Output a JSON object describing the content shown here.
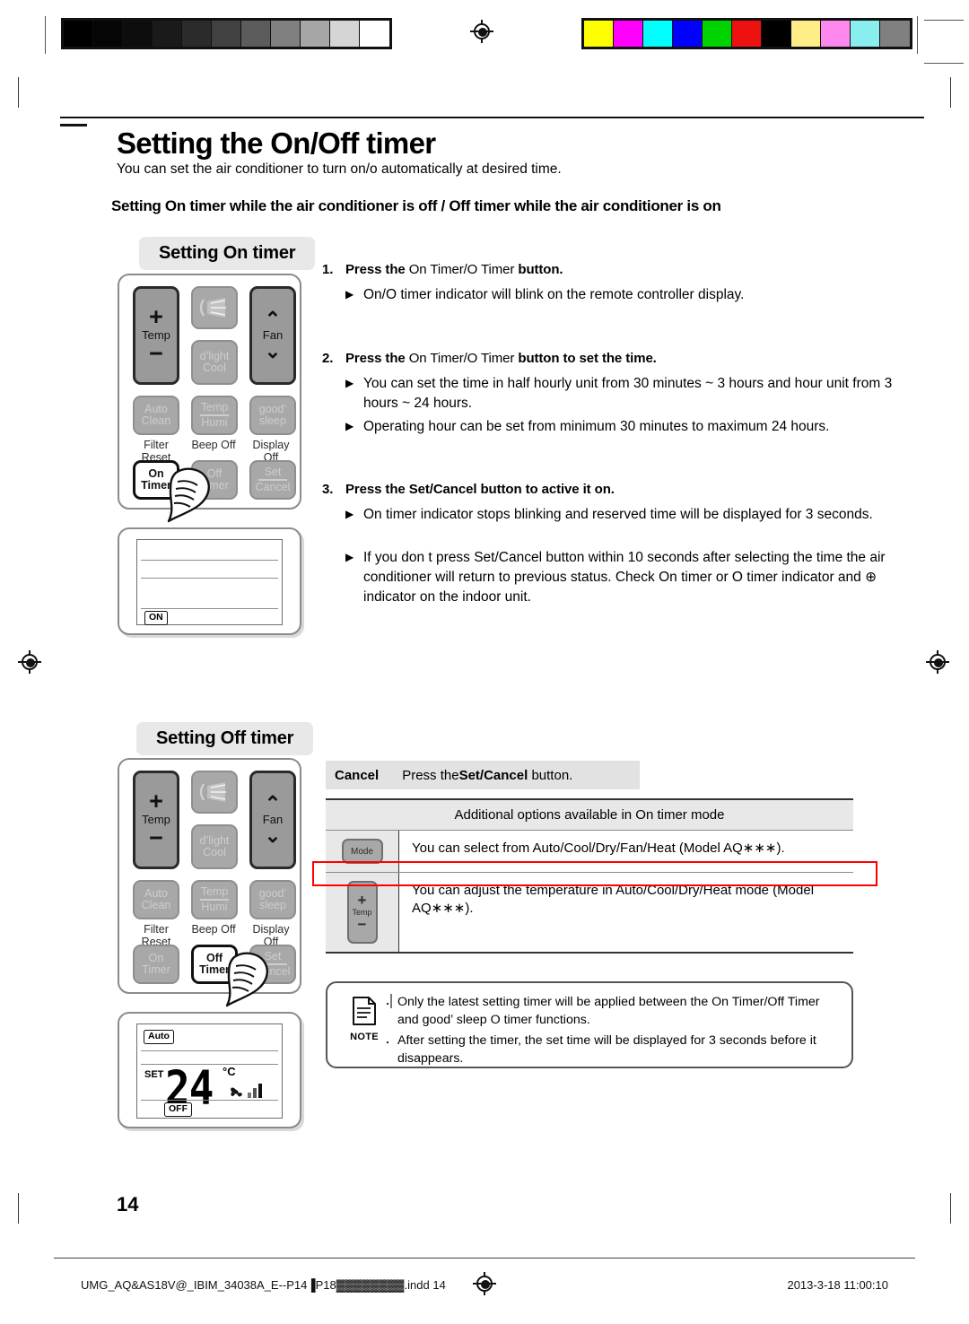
{
  "calibration": {
    "gray_patches": [
      "#000000",
      "#050505",
      "#0d0d0d",
      "#1a1a1a",
      "#2b2b2b",
      "#414141",
      "#5c5c5c",
      "#808080",
      "#a6a6a6",
      "#d5d5d5",
      "#ffffff"
    ],
    "color_patches": [
      "#ffff00",
      "#ff00ff",
      "#00ffff",
      "#0000ff",
      "#00d400",
      "#ee1111",
      "#000000",
      "#ffee88",
      "#ff88ee",
      "#88eeee",
      "#808080"
    ]
  },
  "header": {
    "title": "Setting the On/Off timer",
    "intro": "You can set the air conditioner to turn on/o  automatically at desired time.",
    "subhead": "Setting On timer while the air conditioner is off / Off timer while the air conditioner is on"
  },
  "on_section": {
    "chip": "Setting On timer",
    "remote": {
      "temp_label": "Temp",
      "plus": "+",
      "minus": "−",
      "swing_icon": "air-swing-icon",
      "dlight_top": "d’light",
      "dlight_bottom": "Cool",
      "fan_label": "Fan",
      "fan_up": "⌃",
      "fan_down": "⌄",
      "auto_top": "Auto",
      "auto_bottom": "Clean",
      "temp_humi_top": "Temp",
      "temp_humi_bottom": "Humi",
      "sleep_top": "good’",
      "sleep_bottom": "sleep",
      "cap1": "Filter Reset",
      "cap2": "Beep Off",
      "cap3": "Display Off",
      "on_timer_top": "On",
      "on_timer_bottom": "Timer",
      "off_timer_top": "Off",
      "off_timer_bottom": "Timer",
      "set_top": "Set",
      "set_bottom": "Cancel",
      "highlighted_button": "On Timer"
    },
    "lcd": {
      "badge": "ON"
    }
  },
  "steps": [
    {
      "num": "1.",
      "head_pre": "Press the",
      "head_mid": "On Timer/O  Timer",
      "head_post": "button.",
      "bullets": [
        "On/O  timer indicator will blink on the remote controller display."
      ]
    },
    {
      "num": "2.",
      "head_pre": "Press the",
      "head_mid": "On Timer/O  Timer",
      "head_post": "button to set the time.",
      "bullets": [
        "You can set the time in half hourly unit from 30 minutes ~ 3 hours and hour unit from 3 hours ~ 24 hours.",
        "Operating hour can be set from minimum 30 minutes to maximum 24 hours."
      ]
    },
    {
      "num": "3.",
      "head_pre": "",
      "head_mid": "",
      "head_post": "Press the Set/Cancel button to active it on.",
      "bullets": [
        "On timer indicator stops blinking and reserved time will be displayed for 3 seconds.",
        "If you don t press Set/Cancel button within 10 seconds after selecting the time the air conditioner will return to previous status. Check On timer or O  timer indicator and ⊕ indicator on the indoor unit."
      ]
    }
  ],
  "off_section": {
    "chip": "Setting Off timer",
    "highlighted_button": "Off Timer",
    "lcd": {
      "mode_badge": "Auto",
      "set_label": "SET",
      "value": "24",
      "unit": "°C",
      "fan_icon": "fan-icon",
      "signal_icon": "signal-bars-icon",
      "badge": "OFF"
    }
  },
  "cancel_row": {
    "key": "Cancel",
    "text_pre": "Press the",
    "text_bold": "Set/Cancel",
    "text_post": "button."
  },
  "options_table": {
    "header": "Additional options available in On timer mode",
    "rows": [
      {
        "icon_label": "Mode",
        "icon_name": "mode-button-icon",
        "text": "You can select from Auto/Cool/Dry/Fan/Heat (Model AQ∗∗∗)."
      },
      {
        "icon_label": "Temp",
        "icon_name": "temp-button-icon",
        "icon_plus": "+",
        "icon_minus": "−",
        "text": "You can adjust the temperature in Auto/Cool/Dry/Heat mode (Model AQ∗∗∗)."
      }
    ],
    "annotation_color": "#ff0000"
  },
  "note": {
    "label": "NOTE",
    "items": [
      "Only the latest setting timer will be applied between the On Timer/Off Timer and good’ sleep O  timer functions.",
      "After setting the timer, the set time will be displayed for 3 seconds before it disappears."
    ]
  },
  "page_number": "14",
  "footer": {
    "left": "UMG_AQ&AS18V@_IBIM_34038A_E--P14▐P18▓▓▓▓▓▓▓▓.indd   14",
    "right": "2013-3-18   11:00:10"
  }
}
